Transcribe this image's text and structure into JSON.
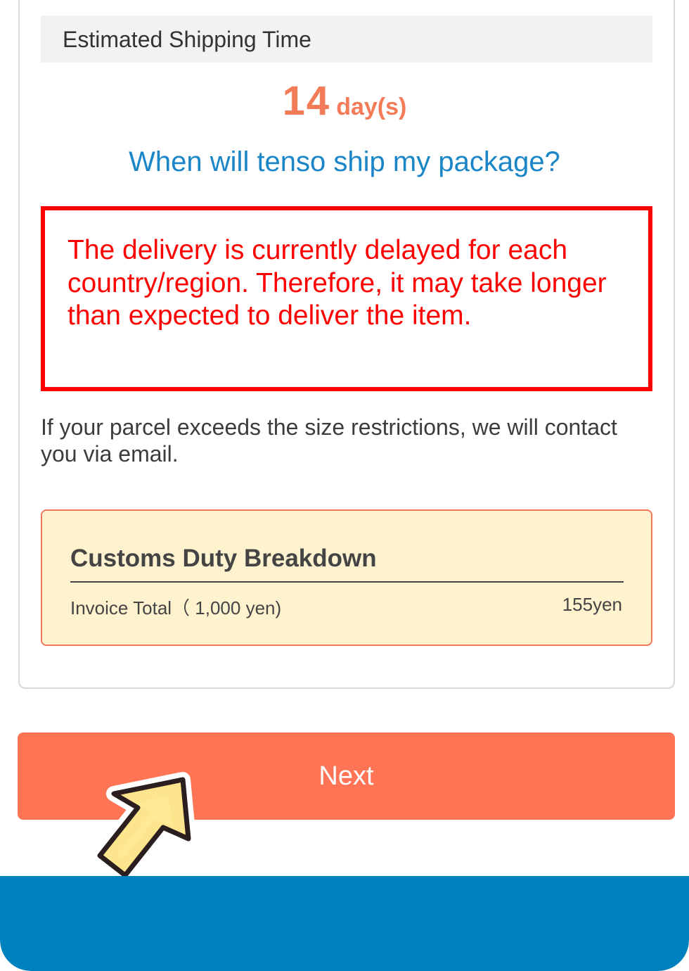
{
  "shipping": {
    "header_label": "Estimated Shipping Time",
    "days_value": "14",
    "days_unit": "day(s)",
    "faq_link": "When will tenso ship my package?"
  },
  "notice": {
    "text": "The delivery is currently delayed for each country/region. Therefore, it may take longer than expected to deliver the item."
  },
  "size_note": "If your parcel exceeds the size restrictions, we will contact you via email.",
  "customs": {
    "title": "Customs Duty Breakdown",
    "invoice_label": "Invoice Total（ 1,000 yen)",
    "invoice_value": "155yen"
  },
  "actions": {
    "next_label": "Next"
  },
  "colors": {
    "accent": "#fe7455",
    "link": "#1a86c8",
    "warning": "#ff0000",
    "footer": "#0081bf",
    "duty_bg": "#fff2cf"
  },
  "icons": {
    "pointer": "pointer-arrow-icon"
  }
}
